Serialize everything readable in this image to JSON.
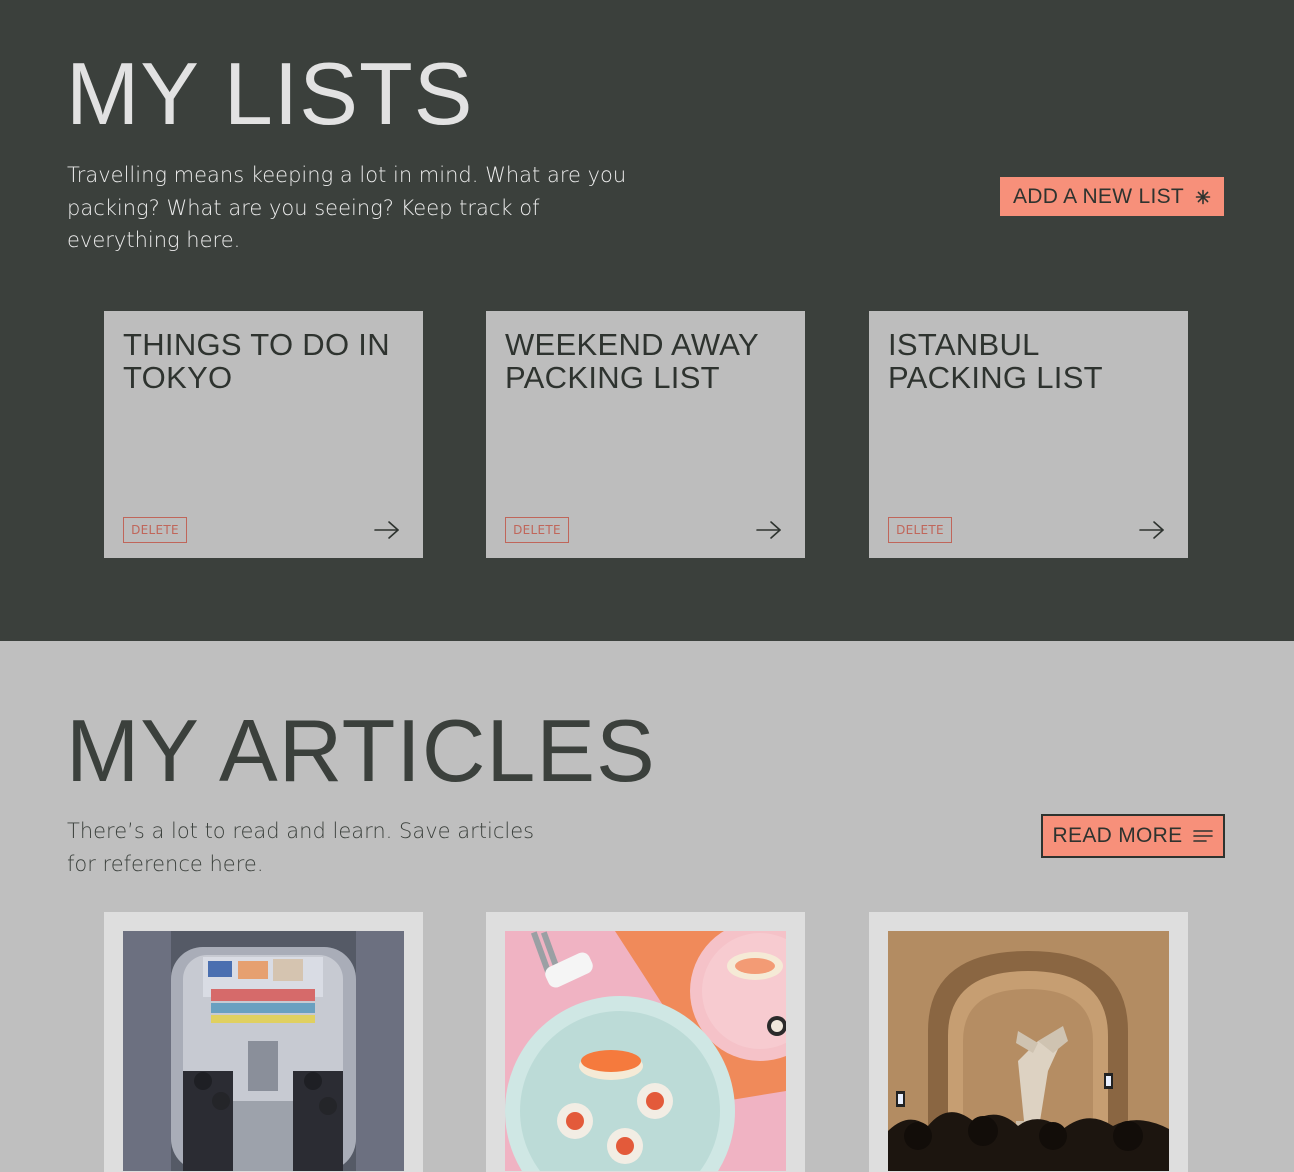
{
  "lists": {
    "heading": "MY LISTS",
    "intro": "Travelling means keeping a lot in mind. What are you packing? What are you seeing? Keep track of everything here.",
    "add_button_label": "ADD A NEW LIST",
    "add_button_icon": "asterisk-icon",
    "cards": [
      {
        "title": "THINGS TO DO IN TOKYO",
        "delete_label": "DELETE",
        "open_icon": "arrow-right-icon"
      },
      {
        "title": "WEEKEND AWAY PACKING LIST",
        "delete_label": "DELETE",
        "open_icon": "arrow-right-icon"
      },
      {
        "title": "ISTANBUL PACKING LIST",
        "delete_label": "DELETE",
        "open_icon": "arrow-right-icon"
      }
    ]
  },
  "articles": {
    "heading": "MY ARTICLES",
    "intro": "There’s a lot to read and learn. Save articles for reference here.",
    "read_more_label": "READ MORE",
    "read_more_icon": "menu-lines-icon",
    "cards": [
      {
        "image": "tokyo-train-interior-photo"
      },
      {
        "image": "sushi-plates-photo"
      },
      {
        "image": "museum-statue-crowd-photo"
      }
    ]
  },
  "colors": {
    "dark_background": "#3b403c",
    "light_background": "#bfbfbf",
    "accent": "#f7907a",
    "delete_red": "#c0665a"
  }
}
